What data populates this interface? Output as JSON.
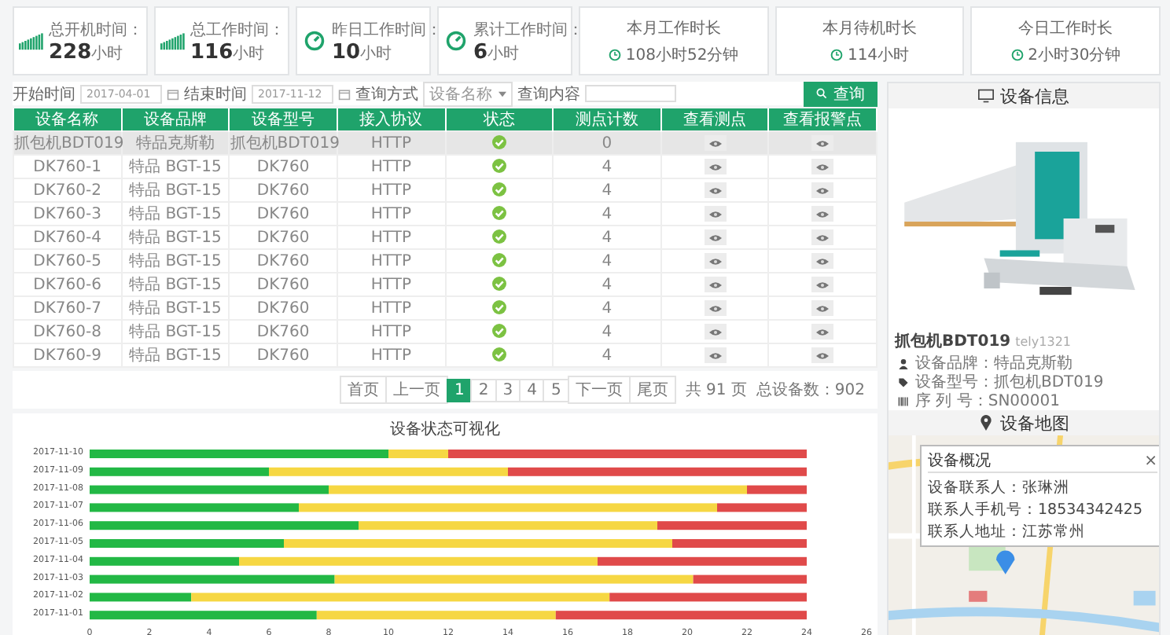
{
  "stat_cards": [
    {
      "kind": "bars",
      "label": "总开机时间：",
      "value": "228",
      "unit": "小时"
    },
    {
      "kind": "bars",
      "label": "总工作时间：",
      "value": "116",
      "unit": "小时"
    },
    {
      "kind": "gauge",
      "label": "昨日工作时间：",
      "value": "10",
      "unit": "小时"
    },
    {
      "kind": "gauge",
      "label": "累计工作时间：",
      "value": "6",
      "unit": "小时"
    }
  ],
  "duration_cards": [
    {
      "label": "本月工作时长",
      "value": "108小时52分钟"
    },
    {
      "label": "本月待机时长",
      "value": "114小时"
    },
    {
      "label": "今日工作时长",
      "value": "2小时30分钟"
    }
  ],
  "filter": {
    "start_label": "开始时间",
    "start_value": "2017-04-01",
    "end_label": "结束时间",
    "end_value": "2017-11-12",
    "mode_label": "查询方式",
    "mode_value": "设备名称",
    "content_label": "查询内容",
    "search_button": "查询"
  },
  "table": {
    "columns": [
      "设备名称",
      "设备品牌",
      "设备型号",
      "接入协议",
      "状态",
      "测点计数",
      "查看测点",
      "查看报警点"
    ],
    "rows": [
      {
        "cells": [
          "抓包机BDT019",
          "特品克斯勒",
          "抓包机BDT019",
          "HTTP"
        ],
        "status_ok": true,
        "count": "0",
        "selected": true
      },
      {
        "cells": [
          "DK760-1",
          "特品 BGT-15",
          "DK760",
          "HTTP"
        ],
        "status_ok": true,
        "count": "4",
        "selected": false
      },
      {
        "cells": [
          "DK760-2",
          "特品 BGT-15",
          "DK760",
          "HTTP"
        ],
        "status_ok": true,
        "count": "4",
        "selected": false
      },
      {
        "cells": [
          "DK760-3",
          "特品 BGT-15",
          "DK760",
          "HTTP"
        ],
        "status_ok": true,
        "count": "4",
        "selected": false
      },
      {
        "cells": [
          "DK760-4",
          "特品 BGT-15",
          "DK760",
          "HTTP"
        ],
        "status_ok": true,
        "count": "4",
        "selected": false
      },
      {
        "cells": [
          "DK760-5",
          "特品 BGT-15",
          "DK760",
          "HTTP"
        ],
        "status_ok": true,
        "count": "4",
        "selected": false
      },
      {
        "cells": [
          "DK760-6",
          "特品 BGT-15",
          "DK760",
          "HTTP"
        ],
        "status_ok": true,
        "count": "4",
        "selected": false
      },
      {
        "cells": [
          "DK760-7",
          "特品 BGT-15",
          "DK760",
          "HTTP"
        ],
        "status_ok": true,
        "count": "4",
        "selected": false
      },
      {
        "cells": [
          "DK760-8",
          "特品 BGT-15",
          "DK760",
          "HTTP"
        ],
        "status_ok": true,
        "count": "4",
        "selected": false
      },
      {
        "cells": [
          "DK760-9",
          "特品 BGT-15",
          "DK760",
          "HTTP"
        ],
        "status_ok": true,
        "count": "4",
        "selected": false
      }
    ]
  },
  "pagination": {
    "pages": [
      {
        "label": "首页",
        "selected": false
      },
      {
        "label": "上一页",
        "selected": false
      },
      {
        "label": "1",
        "selected": true
      },
      {
        "label": "2",
        "selected": false
      },
      {
        "label": "3",
        "selected": false
      },
      {
        "label": "4",
        "selected": false
      },
      {
        "label": "5",
        "selected": false
      },
      {
        "label": "下一页",
        "selected": false
      },
      {
        "label": "尾页",
        "selected": false
      }
    ],
    "page_count": "共 91 页",
    "total": "总设备数：902"
  },
  "chart": {
    "chart_data": {
      "type": "bar",
      "orientation": "horizontal",
      "stacked": true,
      "title": "设备状态可视化",
      "categories": [
        "2017-11-10",
        "2017-11-09",
        "2017-11-08",
        "2017-11-07",
        "2017-11-06",
        "2017-11-05",
        "2017-11-04",
        "2017-11-03",
        "2017-11-02",
        "2017-11-01"
      ],
      "series": [
        {
          "color": "#22b845",
          "values": [
            10,
            6,
            8,
            7,
            9,
            6.5,
            5,
            8.2,
            3.4,
            7.6
          ]
        },
        {
          "color": "#f6d743",
          "values": [
            2,
            8,
            14,
            14,
            10,
            13,
            12,
            12,
            14,
            8
          ]
        },
        {
          "color": "#e04a4a",
          "values": [
            12,
            10,
            2,
            3,
            5,
            4.5,
            7,
            3.8,
            6.6,
            8.4
          ]
        }
      ],
      "xlim": [
        0,
        26
      ],
      "xticks": [
        0,
        2,
        4,
        6,
        8,
        10,
        12,
        14,
        16,
        18,
        20,
        22,
        24,
        26
      ]
    }
  },
  "device_info": {
    "title": "设备信息",
    "name": "抓包机BDT019",
    "code": "tely1321",
    "fields": [
      {
        "kind": "person",
        "text": "设备品牌：特品克斯勒"
      },
      {
        "kind": "tag",
        "text": "设备型号：抓包机BDT019"
      },
      {
        "kind": "barcode",
        "text": "序 列 号：SN00001"
      }
    ]
  },
  "device_map": {
    "title": "设备地图",
    "popup": {
      "title": "设备概况",
      "close": "×",
      "lines": [
        "设备联系人：张琳洲",
        "联系人手机号：18534342425",
        "联系人地址：江苏常州"
      ]
    }
  }
}
